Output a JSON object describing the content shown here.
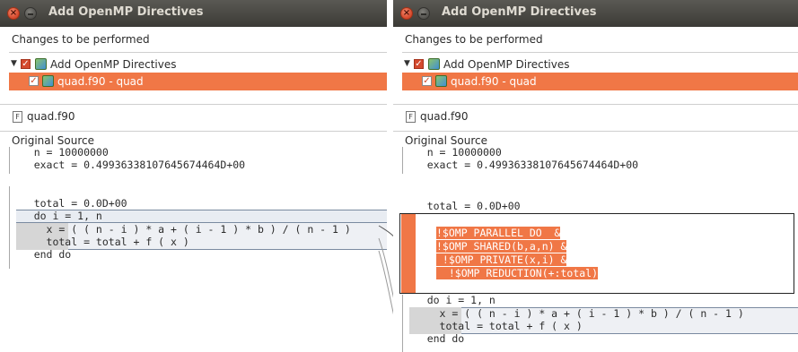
{
  "left": {
    "title": "Add OpenMP Directives",
    "changes_label": "Changes to be performed",
    "tree_root": "Add OpenMP Directives",
    "tree_child": "quad.f90 - quad",
    "file_name": "quad.f90",
    "section_label": "Original Source",
    "code": [
      "    n = 10000000",
      "    exact = 0.49936338107645674464D+00",
      "",
      "    total = 0.0D+00",
      "    do i = 1, n",
      "      x = ( ( n - i ) * a + ( i - 1 ) * b ) / ( n - 1 )",
      "      total = total + f ( x )",
      "    end do"
    ]
  },
  "right": {
    "title": "Add OpenMP Directives",
    "changes_label": "Changes to be performed",
    "tree_root": "Add OpenMP Directives",
    "tree_child": "quad.f90 - quad",
    "file_name": "quad.f90",
    "section_label": "Original Source",
    "code_top": [
      "    n = 10000000",
      "    exact = 0.49936338107645674464D+00",
      "",
      "    total = 0.0D+00"
    ],
    "omp": [
      "!$OMP PARALLEL DO  &",
      "!$OMP SHARED(b,a,n) &",
      " !$OMP PRIVATE(x,i) &",
      "  !$OMP REDUCTION(+:total)"
    ],
    "code_bottom": [
      "    do i = 1, n",
      "      x = ( ( n - i ) * a + ( i - 1 ) * b ) / ( n - 1 )",
      "      total = total + f ( x )",
      "    end do"
    ]
  },
  "icons": {
    "close": "close-icon",
    "minimize": "minimize-icon",
    "check": "checkbox-checked-icon",
    "refactor": "refactor-icon",
    "file": "fortran-file-icon"
  },
  "colors": {
    "accent": "#f07746",
    "titlebar": "#3c3b37",
    "code_highlight": "#d6d6d6"
  }
}
